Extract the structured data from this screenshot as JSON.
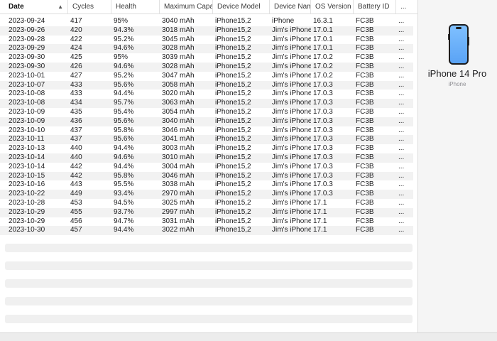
{
  "table": {
    "columns": [
      {
        "label": "Date",
        "sort": "▲"
      },
      {
        "label": "Cycles"
      },
      {
        "label": "Health"
      },
      {
        "label": "Maximum Capacity"
      },
      {
        "label": "Device Model"
      },
      {
        "label": "Device Name"
      },
      {
        "label": "OS Version"
      },
      {
        "label": "Battery ID"
      },
      {
        "label": "..."
      }
    ],
    "rows": [
      [
        "2023-09-24",
        "417",
        "95%",
        "3040 mAh",
        "iPhone15,2",
        "iPhone",
        "16.3.1",
        "FC3B",
        "..."
      ],
      [
        "2023-09-26",
        "420",
        "94.3%",
        "3018 mAh",
        "iPhone15,2",
        "Jim's iPhone",
        "17.0.1",
        "FC3B",
        "..."
      ],
      [
        "2023-09-28",
        "422",
        "95.2%",
        "3045 mAh",
        "iPhone15,2",
        "Jim's iPhone",
        "17.0.1",
        "FC3B",
        "..."
      ],
      [
        "2023-09-29",
        "424",
        "94.6%",
        "3028 mAh",
        "iPhone15,2",
        "Jim's iPhone",
        "17.0.1",
        "FC3B",
        "..."
      ],
      [
        "2023-09-30",
        "425",
        "95%",
        "3039 mAh",
        "iPhone15,2",
        "Jim's iPhone",
        "17.0.2",
        "FC3B",
        "..."
      ],
      [
        "2023-09-30",
        "426",
        "94.6%",
        "3028 mAh",
        "iPhone15,2",
        "Jim's iPhone",
        "17.0.2",
        "FC3B",
        "..."
      ],
      [
        "2023-10-01",
        "427",
        "95.2%",
        "3047 mAh",
        "iPhone15,2",
        "Jim's iPhone",
        "17.0.2",
        "FC3B",
        "..."
      ],
      [
        "2023-10-07",
        "433",
        "95.6%",
        "3058 mAh",
        "iPhone15,2",
        "Jim's iPhone",
        "17.0.3",
        "FC3B",
        "..."
      ],
      [
        "2023-10-08",
        "433",
        "94.4%",
        "3020 mAh",
        "iPhone15,2",
        "Jim's iPhone",
        "17.0.3",
        "FC3B",
        "..."
      ],
      [
        "2023-10-08",
        "434",
        "95.7%",
        "3063 mAh",
        "iPhone15,2",
        "Jim's iPhone",
        "17.0.3",
        "FC3B",
        "..."
      ],
      [
        "2023-10-09",
        "435",
        "95.4%",
        "3054 mAh",
        "iPhone15,2",
        "Jim's iPhone",
        "17.0.3",
        "FC3B",
        "..."
      ],
      [
        "2023-10-09",
        "436",
        "95.6%",
        "3040 mAh",
        "iPhone15,2",
        "Jim's iPhone",
        "17.0.3",
        "FC3B",
        "..."
      ],
      [
        "2023-10-10",
        "437",
        "95.8%",
        "3046 mAh",
        "iPhone15,2",
        "Jim's iPhone",
        "17.0.3",
        "FC3B",
        "..."
      ],
      [
        "2023-10-11",
        "437",
        "95.6%",
        "3041 mAh",
        "iPhone15,2",
        "Jim's iPhone",
        "17.0.3",
        "FC3B",
        "..."
      ],
      [
        "2023-10-13",
        "440",
        "94.4%",
        "3003 mAh",
        "iPhone15,2",
        "Jim's iPhone",
        "17.0.3",
        "FC3B",
        "..."
      ],
      [
        "2023-10-14",
        "440",
        "94.6%",
        "3010 mAh",
        "iPhone15,2",
        "Jim's iPhone",
        "17.0.3",
        "FC3B",
        "..."
      ],
      [
        "2023-10-14",
        "442",
        "94.4%",
        "3004 mAh",
        "iPhone15,2",
        "Jim's iPhone",
        "17.0.3",
        "FC3B",
        "..."
      ],
      [
        "2023-10-15",
        "442",
        "95.8%",
        "3046 mAh",
        "iPhone15,2",
        "Jim's iPhone",
        "17.0.3",
        "FC3B",
        "..."
      ],
      [
        "2023-10-16",
        "443",
        "95.5%",
        "3038 mAh",
        "iPhone15,2",
        "Jim's iPhone",
        "17.0.3",
        "FC3B",
        "..."
      ],
      [
        "2023-10-22",
        "449",
        "93.4%",
        "2970 mAh",
        "iPhone15,2",
        "Jim's iPhone",
        "17.0.3",
        "FC3B",
        "..."
      ],
      [
        "2023-10-28",
        "453",
        "94.5%",
        "3025 mAh",
        "iPhone15,2",
        "Jim's iPhone",
        "17.1",
        "FC3B",
        "..."
      ],
      [
        "2023-10-29",
        "455",
        "93.7%",
        "2997 mAh",
        "iPhone15,2",
        "Jim's iPhone",
        "17.1",
        "FC3B",
        "..."
      ],
      [
        "2023-10-29",
        "456",
        "94.7%",
        "3031 mAh",
        "iPhone15,2",
        "Jim's iPhone",
        "17.1",
        "FC3B",
        "..."
      ],
      [
        "2023-10-30",
        "457",
        "94.4%",
        "3022 mAh",
        "iPhone15,2",
        "Jim's iPhone",
        "17.1",
        "FC3B",
        "..."
      ]
    ]
  },
  "device": {
    "name": "iPhone 14 Pro",
    "type": "iPhone",
    "icon": "iphone-icon",
    "screen_color": "#6bb1fb"
  },
  "colors": {
    "row_alt": "#f2f2f2",
    "side_panel": "#f5f5f5"
  }
}
